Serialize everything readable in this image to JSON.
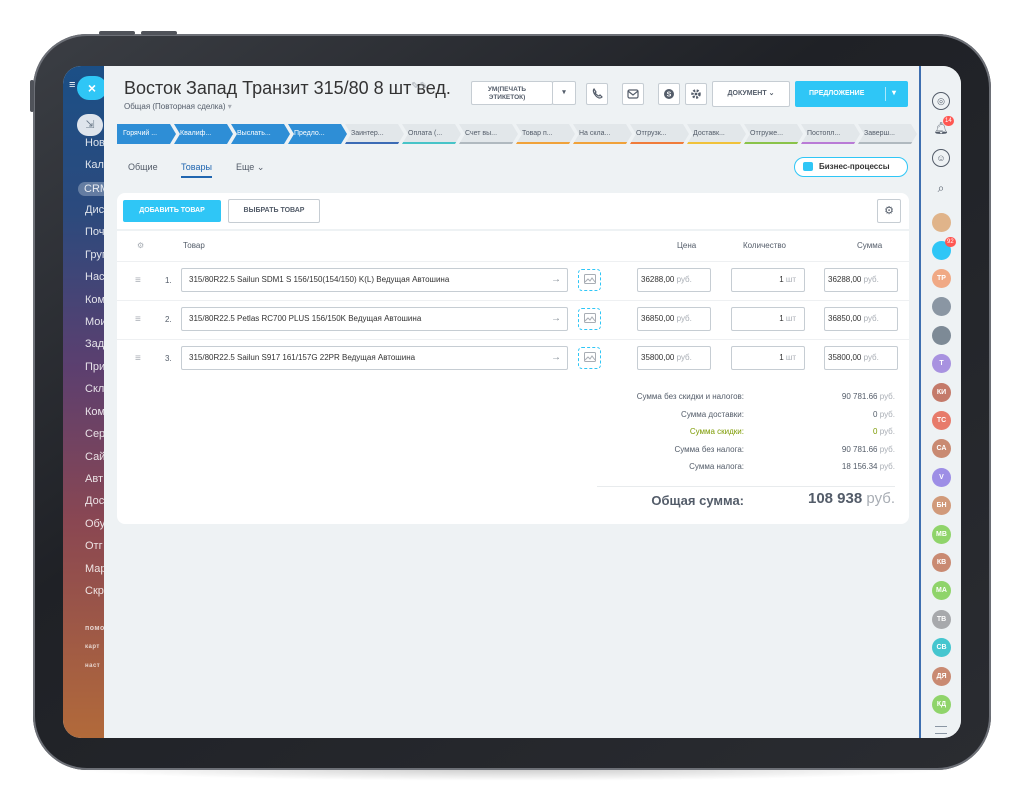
{
  "deal": {
    "title": "Восток Запад Транзит 315/80 8 шт вед.",
    "subtitle": "Общая (Повторная сделка)"
  },
  "toolbar": {
    "print_labels": "УМ(ПЕЧАТЬ ЭТИКЕТОК)",
    "document": "ДОКУМЕНТ",
    "proposal": "ПРЕДЛОЖЕНИЕ"
  },
  "stages": [
    {
      "label": "Горячий ...",
      "done": true,
      "color": "#2e8ed6"
    },
    {
      "label": "Квалиф...",
      "done": true,
      "color": "#2e8ed6"
    },
    {
      "label": "Выслать...",
      "done": true,
      "color": "#2e8ed6"
    },
    {
      "label": "Предло...",
      "done": true,
      "color": "#2e8ed6"
    },
    {
      "label": "Заинтер...",
      "done": false,
      "color": "#3b6bb5"
    },
    {
      "label": "Оплата (...",
      "done": false,
      "color": "#47c4c8"
    },
    {
      "label": "Счет вы...",
      "done": false,
      "color": "#b0b9bf"
    },
    {
      "label": "Товар п...",
      "done": false,
      "color": "#f0a23a"
    },
    {
      "label": "На скла...",
      "done": false,
      "color": "#f0a23a"
    },
    {
      "label": "Отгрузк...",
      "done": false,
      "color": "#f07c3a"
    },
    {
      "label": "Доставк...",
      "done": false,
      "color": "#f0c23a"
    },
    {
      "label": "Отгруже...",
      "done": false,
      "color": "#8ac34a"
    },
    {
      "label": "Постопл...",
      "done": false,
      "color": "#b97bd6"
    },
    {
      "label": "Заверш...",
      "done": false,
      "color": "#b0b9bf"
    }
  ],
  "tabs": {
    "general": "Общие",
    "products": "Товары",
    "more": "Еще"
  },
  "business_processes": "Бизнес-процессы",
  "products": {
    "add_button": "ДОБАВИТЬ ТОВАР",
    "select_button": "ВЫБРАТЬ ТОВАР",
    "columns": {
      "product": "Товар",
      "price": "Цена",
      "quantity": "Количество",
      "sum": "Сумма"
    },
    "rows": [
      {
        "num": "1.",
        "name": "315/80R22.5 Sailun SDM1 S 156/150(154/150) K(L) Ведущая Автошина",
        "price": "36288,00",
        "currency": "руб.",
        "qty": "1",
        "unit": "шт",
        "sum": "36288,00"
      },
      {
        "num": "2.",
        "name": "315/80R22.5 Petlas RC700 PLUS 156/150K Ведущая Автошина",
        "price": "36850,00",
        "currency": "руб.",
        "qty": "1",
        "unit": "шт",
        "sum": "36850,00"
      },
      {
        "num": "3.",
        "name": "315/80R22.5 Sailun S917 161/157G 22PR Ведущая Автошина",
        "price": "35800,00",
        "currency": "руб.",
        "qty": "1",
        "unit": "шт",
        "sum": "35800,00"
      }
    ]
  },
  "totals": {
    "lines": [
      {
        "label": "Сумма без скидки и налогов:",
        "value": "90 781.66",
        "currency": "руб.",
        "highlight": false
      },
      {
        "label": "Сумма доставки:",
        "value": "0",
        "currency": "руб.",
        "highlight": false
      },
      {
        "label": "Сумма скидки:",
        "value": "0",
        "currency": "руб.",
        "highlight": true
      },
      {
        "label": "Сумма без налога:",
        "value": "90 781.66",
        "currency": "руб.",
        "highlight": false
      },
      {
        "label": "Сумма налога:",
        "value": "18 156.34",
        "currency": "руб.",
        "highlight": false
      }
    ],
    "grand_label": "Общая сумма:",
    "grand_value": "108 938",
    "grand_currency": "руб."
  },
  "left_nav": {
    "items": [
      "Нов",
      "Кале",
      "CRM",
      "Дис",
      "Почт",
      "Груп",
      "Наст",
      "Ком",
      "Мои",
      "Зада",
      "При",
      "Скла",
      "Ком",
      "Сер",
      "Сай",
      "Авт",
      "Дос",
      "Обу",
      "Отг",
      "Мар",
      "Скр"
    ],
    "footer": [
      "помо",
      "карт",
      "наст"
    ]
  },
  "right_bar": {
    "notifications_badge": "14",
    "chat_badge": "92",
    "avatars": [
      {
        "initials": "ТР",
        "color": "#f0a985"
      },
      {
        "initials": "",
        "color": "#8a96a3"
      },
      {
        "initials": "",
        "color": "#7d8a96"
      },
      {
        "initials": "Т",
        "color": "#a892e0"
      },
      {
        "initials": "КИ",
        "color": "#c47a6a"
      },
      {
        "initials": "ТС",
        "color": "#e77b6b"
      },
      {
        "initials": "СА",
        "color": "#c98a72"
      },
      {
        "initials": "V",
        "color": "#9d8ee6"
      },
      {
        "initials": "БН",
        "color": "#d19a7a"
      },
      {
        "initials": "МВ",
        "color": "#8fd46a"
      },
      {
        "initials": "КВ",
        "color": "#c98a72"
      },
      {
        "initials": "МА",
        "color": "#8fd46a"
      },
      {
        "initials": "ТВ",
        "color": "#a7a9ac"
      },
      {
        "initials": "СВ",
        "color": "#45c6cf"
      },
      {
        "initials": "ДЯ",
        "color": "#c98a72"
      },
      {
        "initials": "КД",
        "color": "#8fd46a"
      }
    ]
  },
  "colors": {
    "accent": "#2fc6f6",
    "stage_done": "#2e8ed6",
    "link": "#2066b0",
    "discount": "#7c9a00"
  }
}
